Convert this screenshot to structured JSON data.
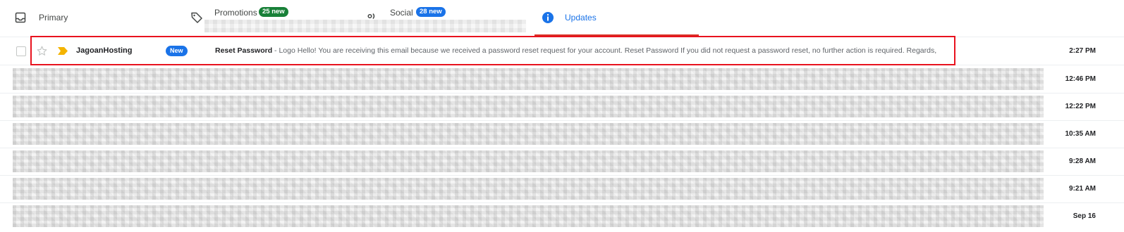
{
  "tabs": {
    "primary": {
      "label": "Primary",
      "icon": "inbox-icon"
    },
    "promotions": {
      "label": "Promotions",
      "badge": "25 new",
      "icon": "tag-icon",
      "badge_color": "#188038"
    },
    "social": {
      "label": "Social",
      "badge": "28 new",
      "icon": "people-icon",
      "badge_color": "#1a73e8"
    },
    "updates": {
      "label": "Updates",
      "icon": "info-icon",
      "active": true,
      "accent": "#1a73e8"
    }
  },
  "emails": [
    {
      "sender": "JagoanHosting",
      "chip": "New",
      "subject": "Reset Password",
      "separator": "-",
      "snippet": "Logo Hello! You are receiving this email because we received a password reset request for your account. Reset Password If you did not request a password reset, no further action is required. Regards,",
      "time": "2:27 PM",
      "unread": true,
      "highlighted": true
    },
    {
      "time": "12:46 PM",
      "redacted": true
    },
    {
      "time": "12:22 PM",
      "redacted": true
    },
    {
      "time": "10:35 AM",
      "redacted": true
    },
    {
      "time": "9:28 AM",
      "redacted": true
    },
    {
      "time": "9:21 AM",
      "redacted": true
    },
    {
      "time": "Sep 16",
      "redacted": true
    }
  ],
  "colors": {
    "highlight_border": "#e8121e",
    "importance_marker": "#f4b400",
    "new_chip": "#1a73e8"
  }
}
